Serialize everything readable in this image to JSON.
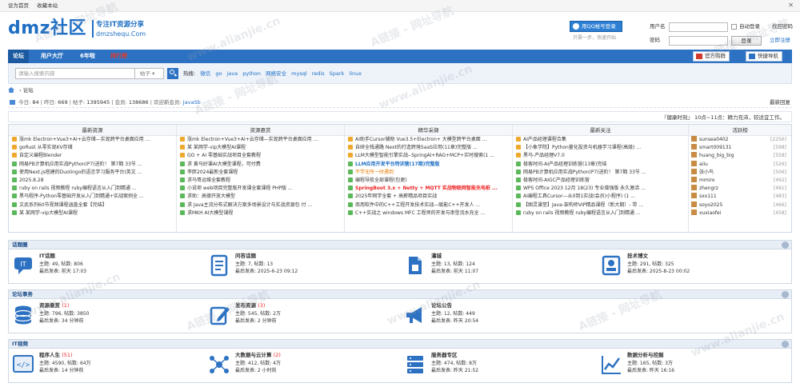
{
  "topbar": {
    "home": "设为首页",
    "fav": "收藏本站"
  },
  "header": {
    "logo": "dmz社区",
    "slogan": "专注IT资源分享",
    "domain": "dmzshequ.Com",
    "qq_login": "用QQ帐号登录",
    "qq_sub": "只需一步，快速开始",
    "login": {
      "user_label": "用户名",
      "pass_label": "密码",
      "remember": "自动登录",
      "find_pass": "找回密码",
      "login_btn": "登录",
      "register": "立即注册"
    }
  },
  "nav": {
    "items": [
      "论坛",
      "用户大厅",
      "6年啦",
      "排行榜"
    ],
    "official": "官方购群",
    "quick": "快捷导航"
  },
  "search": {
    "placeholder": "请输入搜索内容",
    "type": "帖子",
    "hot_label": "热搜:",
    "hot": [
      "微信",
      "go",
      "java",
      "python",
      "网络安全",
      "mysql",
      "redis",
      "Spark",
      "linux"
    ]
  },
  "breadcrumb": {
    "sep": "›",
    "current": "论坛"
  },
  "stats": {
    "text": "今日: 84 | 昨日: 669 | 帖子: 1395945 | 会员: 138686 | 欢迎新会员: JavaSb",
    "today_label": "今日:",
    "today": "84",
    "yesterday_label": "昨日:",
    "yesterday": "669",
    "posts_label": "帖子:",
    "posts": "1395945",
    "members_label": "会员:",
    "members": "138686",
    "newest_label": "欢迎新会员:",
    "newest": "JavaSb",
    "latest_link": "最新回复"
  },
  "notice": "『健康时刻』 10点~11点：精力充沛，较适宜工作。",
  "grid": {
    "heads": [
      "最新资源",
      "资源悬赏",
      "精华采撷",
      "最新关注",
      "活跃榜"
    ],
    "col1": [
      "涨mk Electron+Vue3+AI+云存储—实现跨平台桌面应用 ...",
      "goRust 从零实现KV存储",
      "自定义编程Blender",
      "网易PB计算机应用实战Python(P7)进阶！ 第7期 33节 ...",
      "使用Next.js搭建的Duolingo的语言学习服务平台(英文 ...",
      "2025.8.28",
      "ruby on rails 视频教程 ruby编程语言从入门到精通 ...",
      "黑马程序-Python零基础开发从入门到精通+实战案例全 ...",
      "文武系列60节视频课程涵盖全套【完结】",
      "某 某网学-vip大模型AI课程"
    ],
    "col2": [
      "涨mk Electron+Vue3+AI+云存储—实现跨平台桌面应用 ...",
      "某 某网学-vip大模型AI课程",
      "GO + AI 零基础实战项目全套教程",
      "求 黄马好课AI大模型课程，可付费",
      "李胖2024最新全套课程",
      "求马哥运维全套教程",
      "小说项 web项目完整版开发课全套课程 PHP版 ...",
      "求助：高德开放大模型",
      "求 Java主流分布式解决方案多场景设计与实战资源包 付 ...",
      "求MKH AI大模型课程"
    ],
    "col3": [
      "AI助手Cursor辅助 Vue3.5+Electron+ 大模型跨平台桌面 ...",
      "自研全栈通路 Next的打造跨境SaaS应用(11章)完整版 ...",
      "LLM大模型智能引擎实战--SpringAI+RAG+MCP+实时搜索(1 ...",
      "LLM应用开发平台特训营(17期)完整版",
      "不学无所一时遇到",
      "编程导航全部课程(包更)",
      "SpringBoot 3.x + Netty + MQTT 实战物联网智能充电桩 ...",
      "2025年网学全套 + 高薪精品项目实战",
      "商用软件中的C++工程开发技术实战—赋能C++开发人 ...",
      "C++实战之 windows MFC 工程师的开发与串型流水充全 ..."
    ],
    "col4": [
      "AI产品经理课程合集",
      "【小象学院】Python量化投资与机器学习课程(高级) ...",
      "黑马-产品经理V7.0",
      "极客时间-AI产品经理训练营(13章)完结",
      "网易PB计算机应用实战Python(P7)进阶！ 第7期 33节 ...",
      "极客时间-AIGC产品经理训练营",
      "WPS Office 2023 12月 18(23) 专业增强版 永久激活 ...",
      "AI编程工具Cursor—从0到1实战(会员)小程序) (1 ...",
      "【图灵课堂】Java-架构师VIP精品课程（新大期）- 带 ...",
      "ruby on rails 视频教程 ruby编程语言从入门到精通 ..."
    ],
    "rank": [
      {
        "name": "sunsea0402",
        "count": "[2256]"
      },
      {
        "name": "smart009131",
        "count": "[598]"
      },
      {
        "name": "huang_big_big",
        "count": "[558]"
      },
      {
        "name": "aiiu",
        "count": "[526]"
      },
      {
        "name": "张小鸟",
        "count": "[506]"
      },
      {
        "name": "mmiro",
        "count": "[492]"
      },
      {
        "name": "zhengrz",
        "count": "[491]"
      },
      {
        "name": "sxx111",
        "count": "[483]"
      },
      {
        "name": "soyo2025",
        "count": "[466]"
      },
      {
        "name": "xuxiaofei",
        "count": "[458]"
      }
    ]
  },
  "sec1": {
    "title": "话题圈",
    "forums": [
      {
        "name": "IT话题",
        "today": "",
        "l1": "主题: 49, 帖数: 806",
        "l2": "最后发表: 前天 17:03"
      },
      {
        "name": "问答话题",
        "today": "",
        "l1": "主题: 7, 帖数: 13",
        "l2": "最后发表: 2025-6-23 09:12"
      },
      {
        "name": "灌城",
        "today": "",
        "l1": "主题: 13, 帖数: 124",
        "l2": "最后发表: 前天 11:07"
      },
      {
        "name": "技术博文",
        "today": "",
        "l1": "主题: 291, 帖数: 325",
        "l2": "最后发表: 2025-8-23 00:02"
      }
    ]
  },
  "sec2": {
    "title": "论坛事务",
    "forums": [
      {
        "name": "资源悬赏",
        "today": "(1)",
        "l1": "主题: 796, 帖数: 3850",
        "l2": "最后发表: 34 分钟前"
      },
      {
        "name": "发布资源",
        "today": "(3)",
        "l1": "主题: 545, 帖数: 2万",
        "l2": "最后发表: 2 分钟前"
      },
      {
        "name": "论坛公告",
        "today": "",
        "l1": "主题: 12, 帖数: 449",
        "l2": "最后发表: 昨天 20:54"
      }
    ]
  },
  "sec3": {
    "title": "IT视频",
    "forums": [
      {
        "name": "程序人生",
        "today": "(51)",
        "l1": "主题: 4590, 帖数: 64万",
        "l2": "最后发表: 14 分钟前"
      },
      {
        "name": "大数据与云计算",
        "today": "(2)",
        "l1": "主题: 412, 帖数: 4万",
        "l2": "最后发表: 2 小时前"
      },
      {
        "name": "服务器专区",
        "today": "",
        "l1": "主题: 474, 帖数: 8万",
        "l2": "最后发表: 昨天 21:52"
      },
      {
        "name": "数据分析与挖掘",
        "today": "",
        "l1": "主题: 165, 帖数: 3万",
        "l2": "最后发表: 昨天 16:16"
      }
    ]
  },
  "watermark": [
    "A链接 - 网址导航",
    "www.alianjie.cn"
  ]
}
